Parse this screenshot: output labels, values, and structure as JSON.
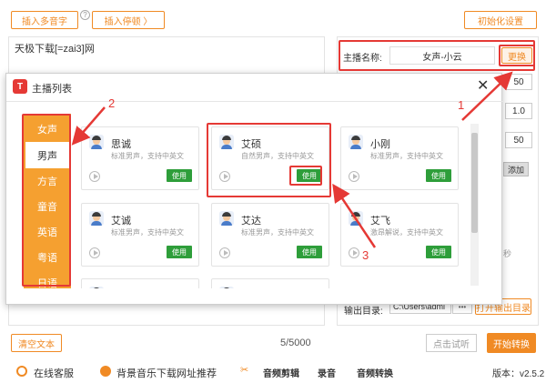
{
  "toolbar": {
    "insert_polyphone": "插入多音字",
    "insert_pause": "插入停顿 〉",
    "help_icon": "?",
    "init_settings": "初始化设置"
  },
  "editor": {
    "text": "天极下载[=zai3]网",
    "clear_button": "清空文本",
    "char_count": "5/5000"
  },
  "right_panel": {
    "anchor_label": "主播名称:",
    "anchor_value": "女声-小云",
    "change_button": "更换",
    "field1": "50",
    "field2": "1.0",
    "field3": "50",
    "add_button": "添加",
    "seconds_label": "秒",
    "output_label": "输出目录:",
    "output_path": "C:\\Users\\admi",
    "dots": "•••",
    "open_output": "打开输出目录",
    "preview_button": "点击试听",
    "start_button": "开始转换"
  },
  "modal": {
    "title": "主播列表",
    "logo_text": "T",
    "close": "✕",
    "categories": [
      "女声",
      "男声",
      "方言",
      "童音",
      "英语",
      "粤语",
      "日语"
    ],
    "use_label": "使用",
    "voices": [
      {
        "name": "思诚",
        "desc": "标准男声，支持中英文"
      },
      {
        "name": "艾硕",
        "desc": "自然男声，支持中英文"
      },
      {
        "name": "小刚",
        "desc": "标准男声，支持中英文"
      },
      {
        "name": "艾诚",
        "desc": "标准男声，支持中英文"
      },
      {
        "name": "艾达",
        "desc": "标准男声，支持中英文"
      },
      {
        "name": "艾飞",
        "desc": "激昂解说，支持中英文"
      }
    ]
  },
  "annotations": [
    "1",
    "2",
    "3"
  ],
  "footer": {
    "online_service": "在线客服",
    "bgm_recommend": "背景音乐下载网址推荐",
    "audio_cut": "音频剪辑",
    "record": "录音",
    "audio_convert": "音频转换",
    "version": "版本：v2.5.2"
  },
  "colors": {
    "accent": "#f08a24",
    "annotation": "#e53935",
    "use_green": "#2e9e3a",
    "category_bg": "#f5a030"
  }
}
